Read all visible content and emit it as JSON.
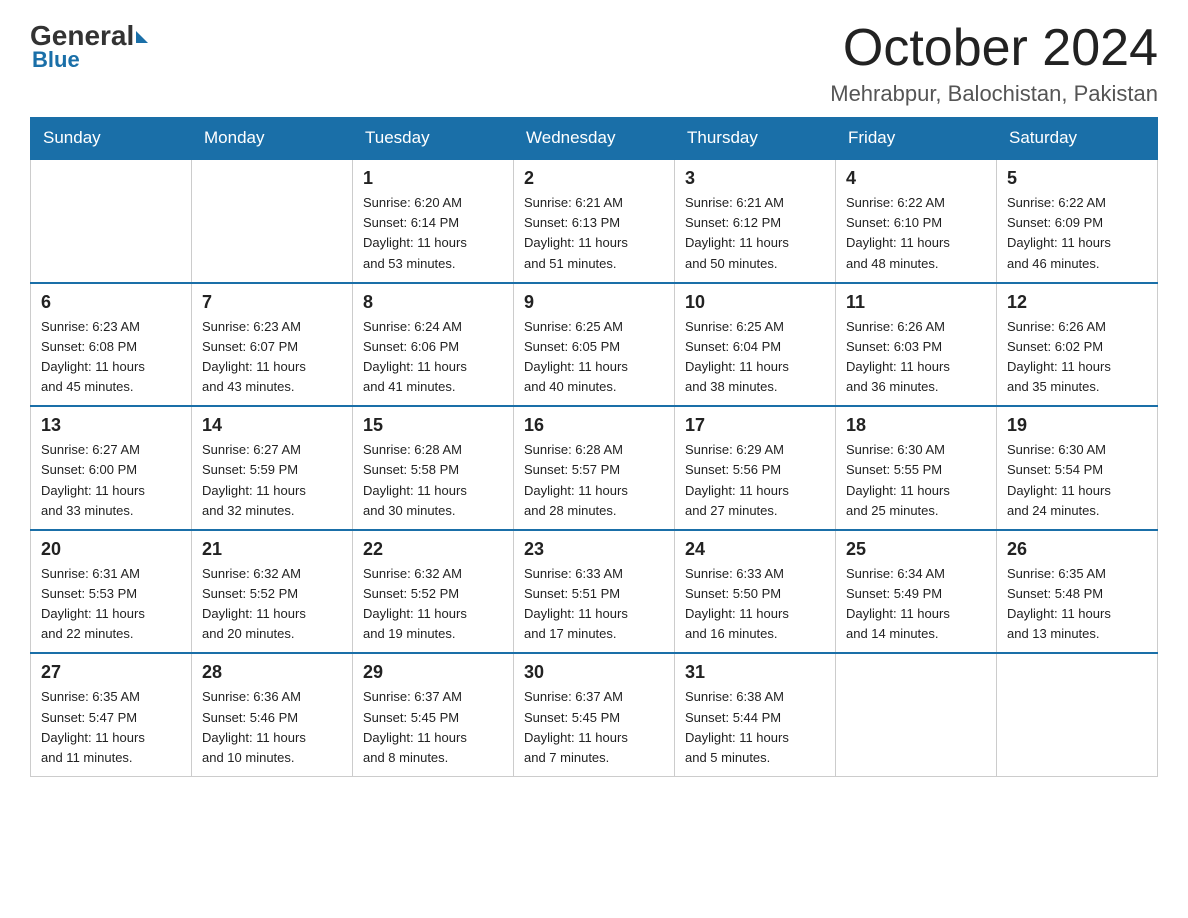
{
  "logo": {
    "general": "General",
    "triangle": "",
    "blue": "Blue"
  },
  "header": {
    "month": "October 2024",
    "location": "Mehrabpur, Balochistan, Pakistan"
  },
  "weekdays": [
    "Sunday",
    "Monday",
    "Tuesday",
    "Wednesday",
    "Thursday",
    "Friday",
    "Saturday"
  ],
  "weeks": [
    [
      {
        "day": "",
        "info": ""
      },
      {
        "day": "",
        "info": ""
      },
      {
        "day": "1",
        "info": "Sunrise: 6:20 AM\nSunset: 6:14 PM\nDaylight: 11 hours\nand 53 minutes."
      },
      {
        "day": "2",
        "info": "Sunrise: 6:21 AM\nSunset: 6:13 PM\nDaylight: 11 hours\nand 51 minutes."
      },
      {
        "day": "3",
        "info": "Sunrise: 6:21 AM\nSunset: 6:12 PM\nDaylight: 11 hours\nand 50 minutes."
      },
      {
        "day": "4",
        "info": "Sunrise: 6:22 AM\nSunset: 6:10 PM\nDaylight: 11 hours\nand 48 minutes."
      },
      {
        "day": "5",
        "info": "Sunrise: 6:22 AM\nSunset: 6:09 PM\nDaylight: 11 hours\nand 46 minutes."
      }
    ],
    [
      {
        "day": "6",
        "info": "Sunrise: 6:23 AM\nSunset: 6:08 PM\nDaylight: 11 hours\nand 45 minutes."
      },
      {
        "day": "7",
        "info": "Sunrise: 6:23 AM\nSunset: 6:07 PM\nDaylight: 11 hours\nand 43 minutes."
      },
      {
        "day": "8",
        "info": "Sunrise: 6:24 AM\nSunset: 6:06 PM\nDaylight: 11 hours\nand 41 minutes."
      },
      {
        "day": "9",
        "info": "Sunrise: 6:25 AM\nSunset: 6:05 PM\nDaylight: 11 hours\nand 40 minutes."
      },
      {
        "day": "10",
        "info": "Sunrise: 6:25 AM\nSunset: 6:04 PM\nDaylight: 11 hours\nand 38 minutes."
      },
      {
        "day": "11",
        "info": "Sunrise: 6:26 AM\nSunset: 6:03 PM\nDaylight: 11 hours\nand 36 minutes."
      },
      {
        "day": "12",
        "info": "Sunrise: 6:26 AM\nSunset: 6:02 PM\nDaylight: 11 hours\nand 35 minutes."
      }
    ],
    [
      {
        "day": "13",
        "info": "Sunrise: 6:27 AM\nSunset: 6:00 PM\nDaylight: 11 hours\nand 33 minutes."
      },
      {
        "day": "14",
        "info": "Sunrise: 6:27 AM\nSunset: 5:59 PM\nDaylight: 11 hours\nand 32 minutes."
      },
      {
        "day": "15",
        "info": "Sunrise: 6:28 AM\nSunset: 5:58 PM\nDaylight: 11 hours\nand 30 minutes."
      },
      {
        "day": "16",
        "info": "Sunrise: 6:28 AM\nSunset: 5:57 PM\nDaylight: 11 hours\nand 28 minutes."
      },
      {
        "day": "17",
        "info": "Sunrise: 6:29 AM\nSunset: 5:56 PM\nDaylight: 11 hours\nand 27 minutes."
      },
      {
        "day": "18",
        "info": "Sunrise: 6:30 AM\nSunset: 5:55 PM\nDaylight: 11 hours\nand 25 minutes."
      },
      {
        "day": "19",
        "info": "Sunrise: 6:30 AM\nSunset: 5:54 PM\nDaylight: 11 hours\nand 24 minutes."
      }
    ],
    [
      {
        "day": "20",
        "info": "Sunrise: 6:31 AM\nSunset: 5:53 PM\nDaylight: 11 hours\nand 22 minutes."
      },
      {
        "day": "21",
        "info": "Sunrise: 6:32 AM\nSunset: 5:52 PM\nDaylight: 11 hours\nand 20 minutes."
      },
      {
        "day": "22",
        "info": "Sunrise: 6:32 AM\nSunset: 5:52 PM\nDaylight: 11 hours\nand 19 minutes."
      },
      {
        "day": "23",
        "info": "Sunrise: 6:33 AM\nSunset: 5:51 PM\nDaylight: 11 hours\nand 17 minutes."
      },
      {
        "day": "24",
        "info": "Sunrise: 6:33 AM\nSunset: 5:50 PM\nDaylight: 11 hours\nand 16 minutes."
      },
      {
        "day": "25",
        "info": "Sunrise: 6:34 AM\nSunset: 5:49 PM\nDaylight: 11 hours\nand 14 minutes."
      },
      {
        "day": "26",
        "info": "Sunrise: 6:35 AM\nSunset: 5:48 PM\nDaylight: 11 hours\nand 13 minutes."
      }
    ],
    [
      {
        "day": "27",
        "info": "Sunrise: 6:35 AM\nSunset: 5:47 PM\nDaylight: 11 hours\nand 11 minutes."
      },
      {
        "day": "28",
        "info": "Sunrise: 6:36 AM\nSunset: 5:46 PM\nDaylight: 11 hours\nand 10 minutes."
      },
      {
        "day": "29",
        "info": "Sunrise: 6:37 AM\nSunset: 5:45 PM\nDaylight: 11 hours\nand 8 minutes."
      },
      {
        "day": "30",
        "info": "Sunrise: 6:37 AM\nSunset: 5:45 PM\nDaylight: 11 hours\nand 7 minutes."
      },
      {
        "day": "31",
        "info": "Sunrise: 6:38 AM\nSunset: 5:44 PM\nDaylight: 11 hours\nand 5 minutes."
      },
      {
        "day": "",
        "info": ""
      },
      {
        "day": "",
        "info": ""
      }
    ]
  ]
}
